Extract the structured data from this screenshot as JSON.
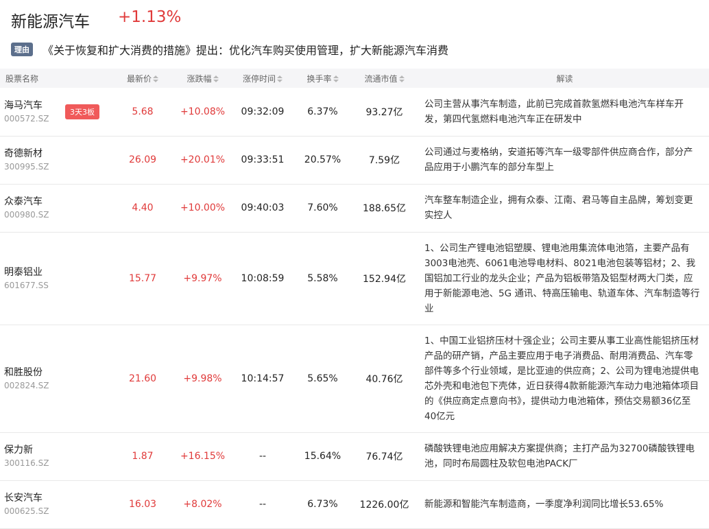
{
  "header": {
    "title": "新能源汽车",
    "change": "+1.13%",
    "reason_tag": "理由",
    "reason_text": "《关于恢复和扩大消费的措施》提出：优化汽车购买使用管理，扩大新能源汽车消费"
  },
  "columns": [
    "股票名称",
    "最新价",
    "涨跌幅",
    "涨停时间",
    "换手率",
    "流通市值",
    "解读"
  ],
  "rows": [
    {
      "name": "海马汽车",
      "code": "000572.SZ",
      "badge": "3天3板",
      "price": "5.68",
      "pct": "+10.08%",
      "time": "09:32:09",
      "turnover": "6.37%",
      "cap": "93.27亿",
      "desc": "公司主营从事汽车制造，此前已完成首款氢燃料电池汽车样车开发，第四代氢燃料电池汽车正在研发中"
    },
    {
      "name": "奇德新材",
      "code": "300995.SZ",
      "badge": "",
      "price": "26.09",
      "pct": "+20.01%",
      "time": "09:33:51",
      "turnover": "20.57%",
      "cap": "7.59亿",
      "desc": "公司通过与麦格纳，安道拓等汽车一级零部件供应商合作，部分产品应用于小鹏汽车的部分车型上"
    },
    {
      "name": "众泰汽车",
      "code": "000980.SZ",
      "badge": "",
      "price": "4.40",
      "pct": "+10.00%",
      "time": "09:40:03",
      "turnover": "7.60%",
      "cap": "188.65亿",
      "desc": "汽车整车制造企业，拥有众泰、江南、君马等自主品牌，筹划变更实控人"
    },
    {
      "name": "明泰铝业",
      "code": "601677.SS",
      "badge": "",
      "price": "15.77",
      "pct": "+9.97%",
      "time": "10:08:59",
      "turnover": "5.58%",
      "cap": "152.94亿",
      "desc": "1、公司生产锂电池铝塑膜、锂电池用集流体电池箔，主要产品有3003电池壳、6061电池导电材料、8021电池包装等铝材；2、我国铝加工行业的龙头企业；产品为铝板带箔及铝型材两大门类，应用于新能源电池、5G 通讯、特高压输电、轨道车体、汽车制造等行业"
    },
    {
      "name": "和胜股份",
      "code": "002824.SZ",
      "badge": "",
      "price": "21.60",
      "pct": "+9.98%",
      "time": "10:14:57",
      "turnover": "5.65%",
      "cap": "40.76亿",
      "desc": "1、中国工业铝挤压材十强企业；公司主要从事工业高性能铝挤压材产品的研产销，产品主要应用于电子消费品、耐用消费品、汽车零部件等多个行业领域，是比亚迪的供应商；2、公司为锂电池提供电芯外壳和电池包下壳体，近日获得4款新能源汽车动力电池箱体项目的《供应商定点意向书》，提供动力电池箱体，预估交易额36亿至40亿元"
    },
    {
      "name": "保力新",
      "code": "300116.SZ",
      "badge": "",
      "price": "1.87",
      "pct": "+16.15%",
      "time": "--",
      "turnover": "15.64%",
      "cap": "76.74亿",
      "desc": "磷酸铁锂电池应用解决方案提供商；主打产品为32700磷酸铁锂电池，同时布局圆柱及软包电池PACK厂"
    },
    {
      "name": "长安汽车",
      "code": "000625.SZ",
      "badge": "",
      "price": "16.03",
      "pct": "+8.02%",
      "time": "--",
      "turnover": "6.73%",
      "cap": "1226.00亿",
      "desc": "新能源和智能汽车制造商，一季度净利润同比增长53.65%"
    }
  ]
}
